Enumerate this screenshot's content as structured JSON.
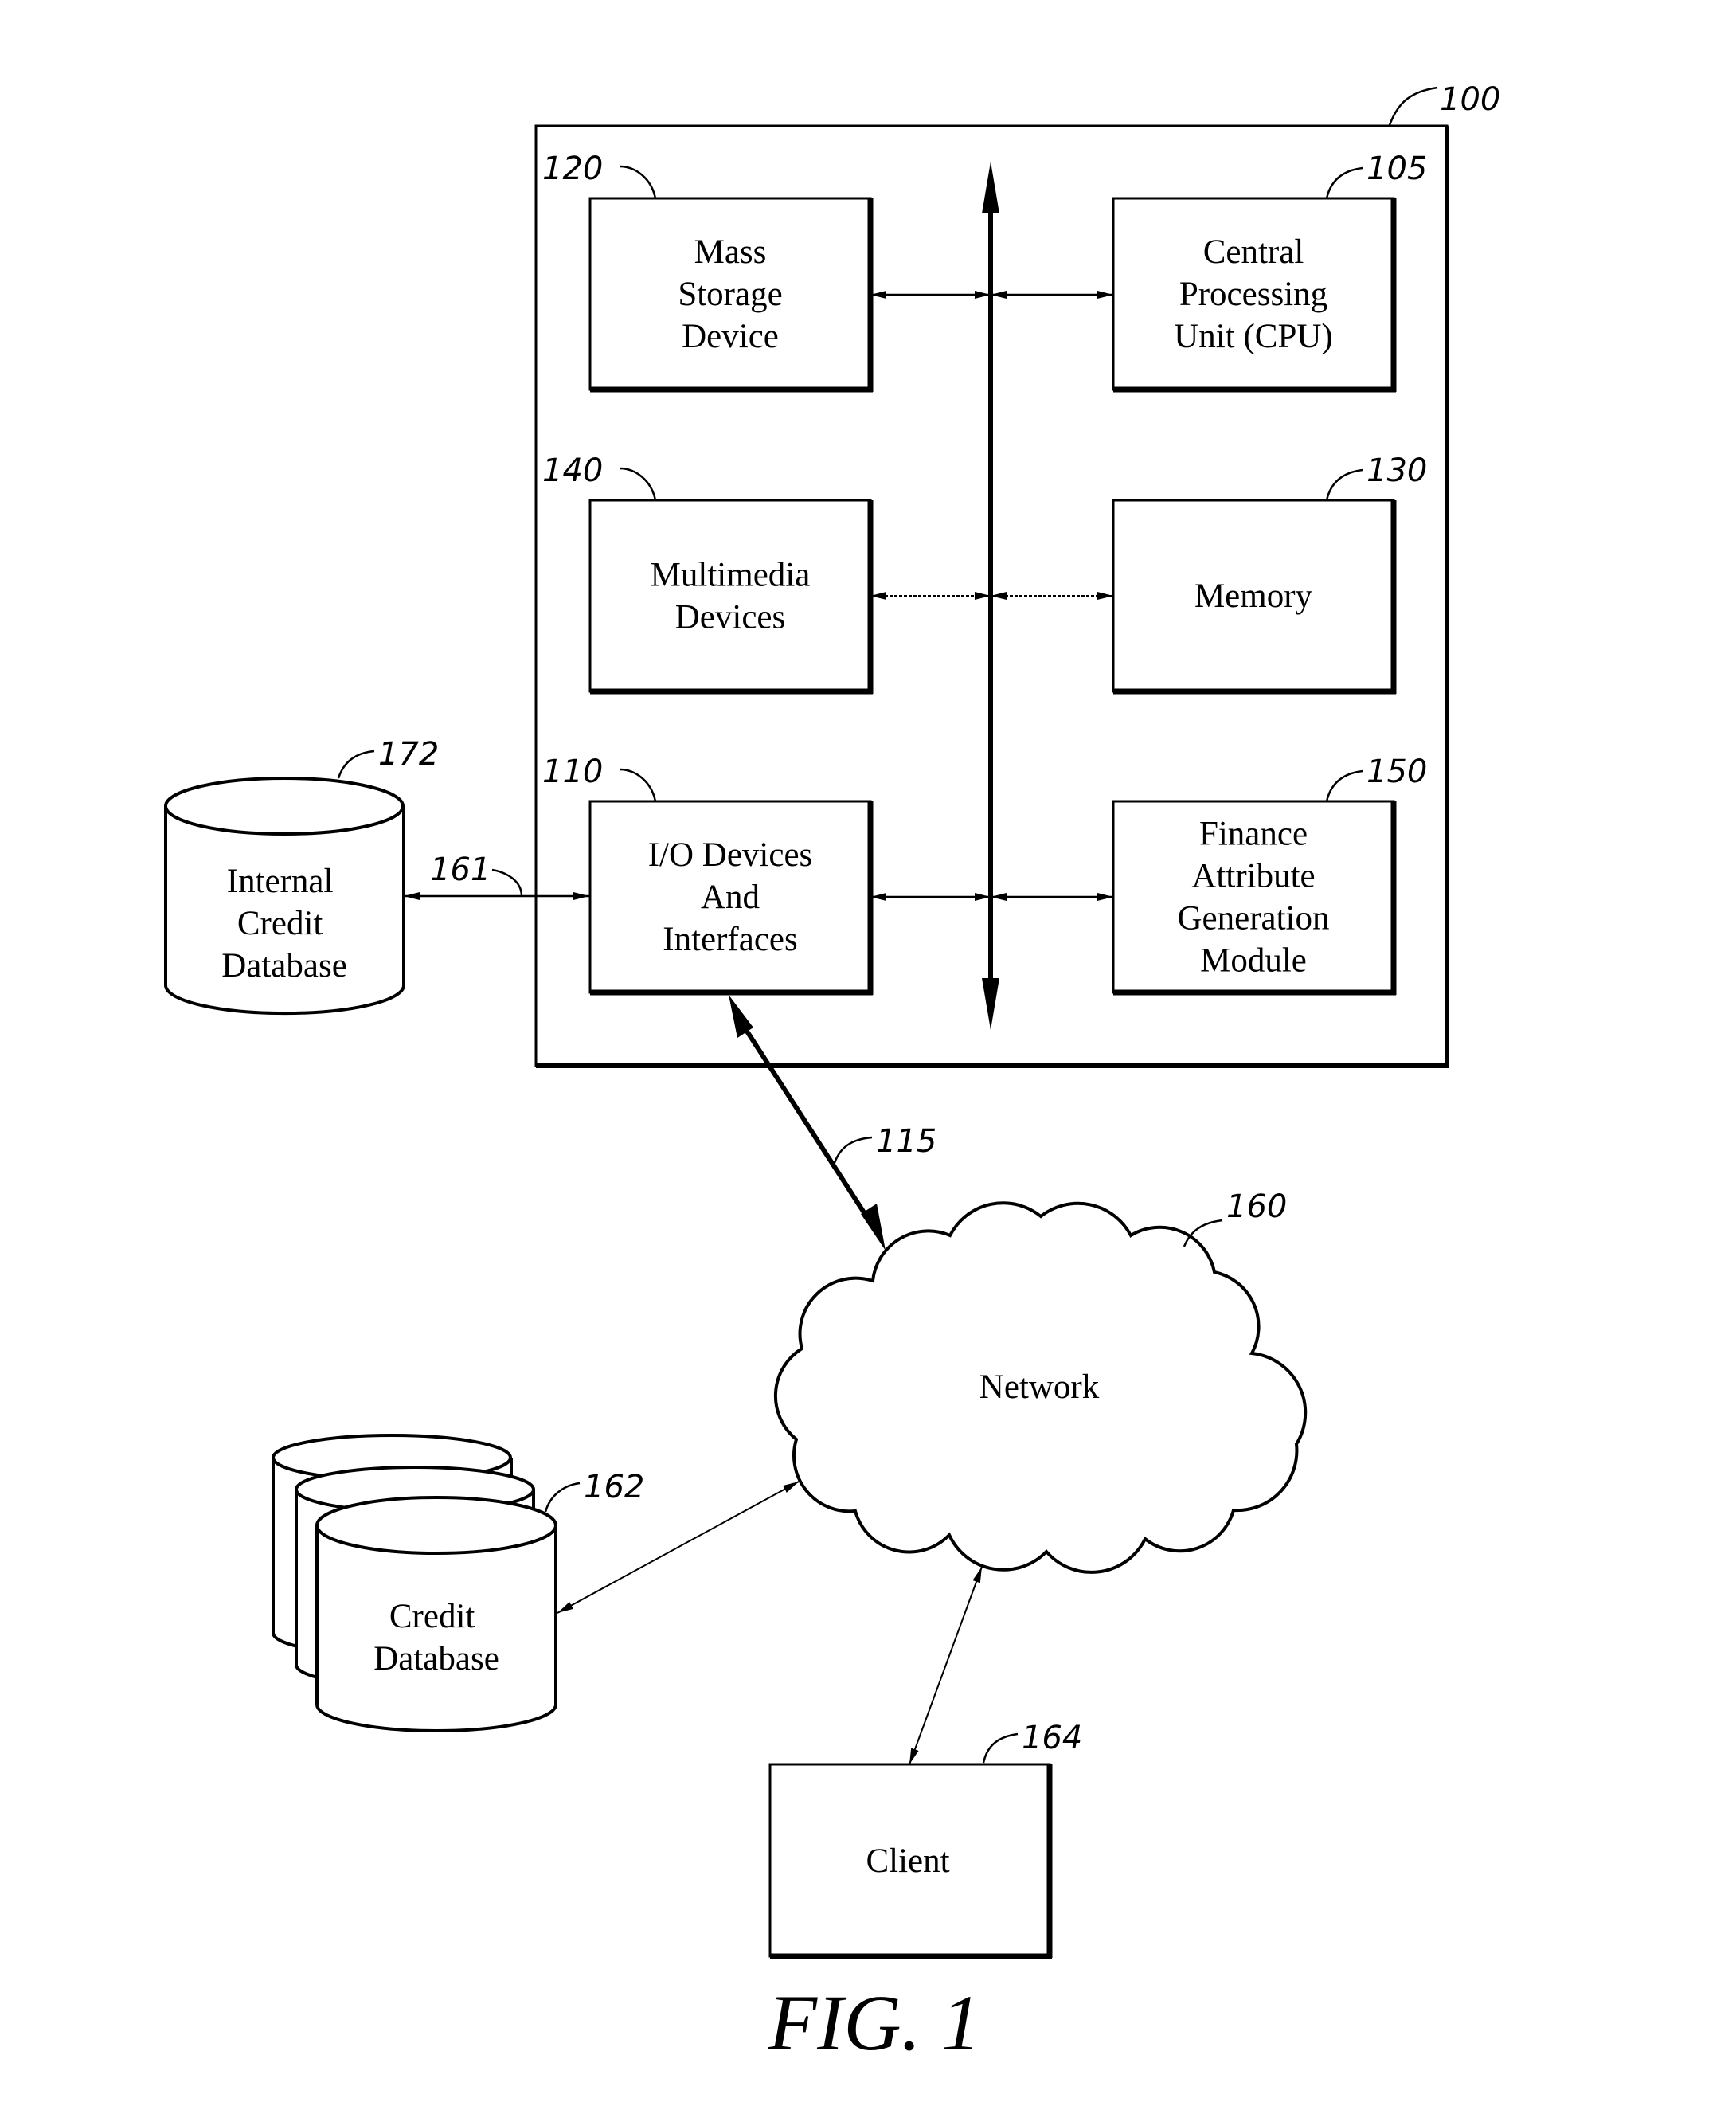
{
  "figure_label": "FIG. 1",
  "system": {
    "ref": "100",
    "bus_ref": "",
    "components": [
      {
        "id": "mass-storage",
        "ref": "120",
        "lines": [
          "Mass",
          "Storage",
          "Device"
        ]
      },
      {
        "id": "cpu",
        "ref": "105",
        "lines": [
          "Central",
          "Processing",
          "Unit (CPU)"
        ]
      },
      {
        "id": "multimedia",
        "ref": "140",
        "lines": [
          "Multimedia",
          "Devices"
        ]
      },
      {
        "id": "memory",
        "ref": "130",
        "lines": [
          "Memory"
        ]
      },
      {
        "id": "io",
        "ref": "110",
        "lines": [
          "I/O Devices",
          "And",
          "Interfaces"
        ]
      },
      {
        "id": "finance-module",
        "ref": "150",
        "lines": [
          "Finance",
          "Attribute",
          "Generation",
          "Module"
        ]
      }
    ]
  },
  "internal_db": {
    "ref": "172",
    "lines": [
      "Internal",
      "Credit",
      "Database"
    ]
  },
  "internal_link": {
    "ref": "161"
  },
  "network_link": {
    "ref": "115"
  },
  "network": {
    "ref": "160",
    "label": "Network"
  },
  "credit_db": {
    "ref": "162",
    "lines": [
      "Credit",
      "Database"
    ]
  },
  "client": {
    "ref": "164",
    "label": "Client"
  }
}
